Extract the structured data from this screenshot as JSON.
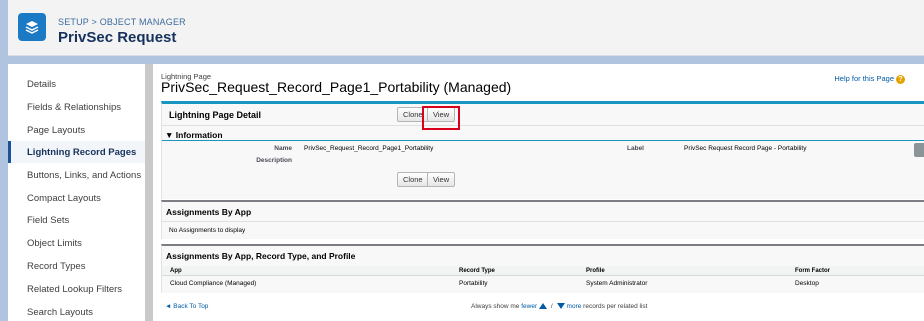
{
  "header": {
    "breadcrumb": "SETUP > OBJECT MANAGER",
    "title": "PrivSec Request",
    "icon": "layers-icon"
  },
  "sidebar": {
    "items": [
      {
        "label": "Details",
        "active": false
      },
      {
        "label": "Fields & Relationships",
        "active": false
      },
      {
        "label": "Page Layouts",
        "active": false
      },
      {
        "label": "Lightning Record Pages",
        "active": true
      },
      {
        "label": "Buttons, Links, and Actions",
        "active": false
      },
      {
        "label": "Compact Layouts",
        "active": false
      },
      {
        "label": "Field Sets",
        "active": false
      },
      {
        "label": "Object Limits",
        "active": false
      },
      {
        "label": "Record Types",
        "active": false
      },
      {
        "label": "Related Lookup Filters",
        "active": false
      },
      {
        "label": "Search Layouts",
        "active": false
      }
    ]
  },
  "main": {
    "small_label": "Lightning Page",
    "title": "PrivSec_Request_Record_Page1_Portability (Managed)",
    "help_link": "Help for this Page",
    "detail": {
      "title": "Lightning Page Detail",
      "clone_label": "Clone",
      "view_label": "View",
      "info_label": "Information",
      "name_label": "Name",
      "name_value": "PrivSec_Request_Record_Page1_Portability",
      "description_label": "Description",
      "label_label": "Label",
      "label_value": "PrivSec Request Record Page - Portability"
    },
    "assignments_by_app": {
      "title": "Assignments By App",
      "empty_text": "No Assignments to display"
    },
    "assignments_full": {
      "title": "Assignments By App, Record Type, and Profile",
      "columns": [
        "App",
        "Record Type",
        "Profile",
        "Form Factor"
      ],
      "rows": [
        [
          "Cloud Compliance (Managed)",
          "Portability",
          "System Administrator",
          "Desktop"
        ]
      ]
    },
    "back_to_top": "Back To Top",
    "always_show": "Always show me",
    "fewer": "fewer",
    "more": "more",
    "records_text": "records per related list"
  },
  "colors": {
    "accent": "#1797c0",
    "highlight": "#d9001b",
    "header_icon": "#1c7ac4",
    "background": "#b0c4df"
  }
}
